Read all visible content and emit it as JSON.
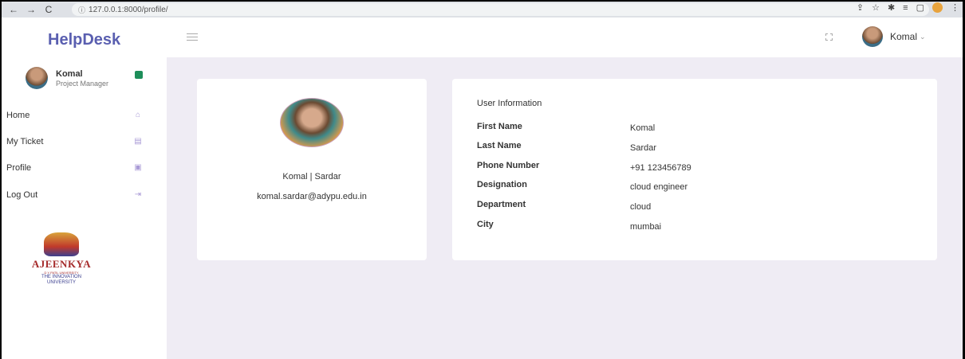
{
  "browser": {
    "back": "←",
    "forward": "→",
    "reload": "C",
    "url": "127.0.0.1:8000/profile/",
    "info_icon": "ⓘ"
  },
  "app": {
    "brand": "HelpDesk"
  },
  "sidebar": {
    "user_name": "Komal",
    "user_role": "Project Manager",
    "items": [
      {
        "label": "Home",
        "icon": "home-icon"
      },
      {
        "label": "My Ticket",
        "icon": "ticket-icon"
      },
      {
        "label": "Profile",
        "icon": "profile-card-icon"
      },
      {
        "label": "Log Out",
        "icon": "logout-icon"
      }
    ],
    "logo": {
      "name": "AJEENKYA",
      "sub": "D Y PATIL UNIVERSITY",
      "tagline_1": "THE INNOVATION",
      "tagline_2": "UNIVERSITY"
    }
  },
  "header": {
    "user_name": "Komal",
    "chevron": "⌄"
  },
  "profile": {
    "display_name": "Komal | Sardar",
    "email": "komal.sardar@adypu.edu.in"
  },
  "user_info": {
    "title": "User Information",
    "rows": [
      {
        "label": "First Name",
        "value": "Komal"
      },
      {
        "label": "Last Name",
        "value": "Sardar"
      },
      {
        "label": "Phone Number",
        "value": "+91 123456789"
      },
      {
        "label": "Designation",
        "value": "cloud engineer"
      },
      {
        "label": "Department",
        "value": "cloud"
      },
      {
        "label": "City",
        "value": "mumbai"
      }
    ]
  },
  "colors": {
    "brand": "#5a5fb0",
    "content_bg": "#efecf4",
    "icon_accent": "#a99ad6"
  }
}
